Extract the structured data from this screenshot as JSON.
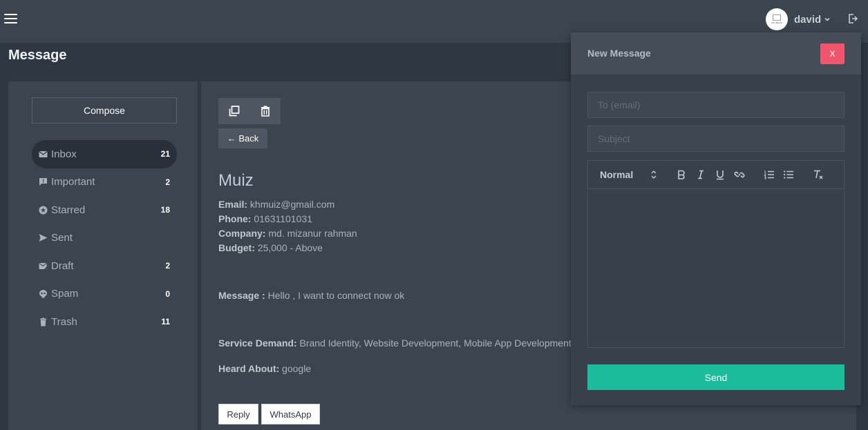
{
  "header": {
    "user": {
      "name": "david",
      "avatar_text": "NO IMAGE"
    }
  },
  "page": {
    "title": "Message"
  },
  "sidebar": {
    "compose_label": "Compose",
    "items": [
      {
        "label": "Inbox",
        "count": "21",
        "icon": "envelope-icon",
        "active": true
      },
      {
        "label": "Important",
        "count": "2",
        "icon": "important-icon"
      },
      {
        "label": "Starred",
        "count": "18",
        "icon": "star-icon"
      },
      {
        "label": "Sent",
        "count": "",
        "icon": "send-icon"
      },
      {
        "label": "Draft",
        "count": "2",
        "icon": "draft-icon"
      },
      {
        "label": "Spam",
        "count": "0",
        "icon": "spam-icon"
      },
      {
        "label": "Trash",
        "count": "11",
        "icon": "trash-icon"
      }
    ]
  },
  "message": {
    "back_label": "← Back",
    "sender_name": "Muiz",
    "fields": [
      {
        "label": "Email:",
        "value": "khmuiz@gmail.com"
      },
      {
        "label": "Phone:",
        "value": "01631101031"
      },
      {
        "label": "Company:",
        "value": "md. mizanur rahman"
      },
      {
        "label": "Budget:",
        "value": "25,000 - Above"
      }
    ],
    "body_label": "Message :",
    "body": "Hello , I want to connect now ok",
    "service_label": "Service Demand:",
    "service": "Brand Identity, Website Development, Mobile App Development",
    "heard_label": "Heard About:",
    "heard": "google",
    "reply_label": "Reply",
    "whatsapp_label": "WhatsApp"
  },
  "modal": {
    "title": "New Message",
    "close_label": "X",
    "to_placeholder": "To (email)",
    "subject_placeholder": "Subject",
    "format_selected": "Normal",
    "send_label": "Send"
  },
  "colors": {
    "accent": "#1abc9c",
    "danger": "#f1556c",
    "background": "#2f3742",
    "panel": "#3b444f"
  }
}
